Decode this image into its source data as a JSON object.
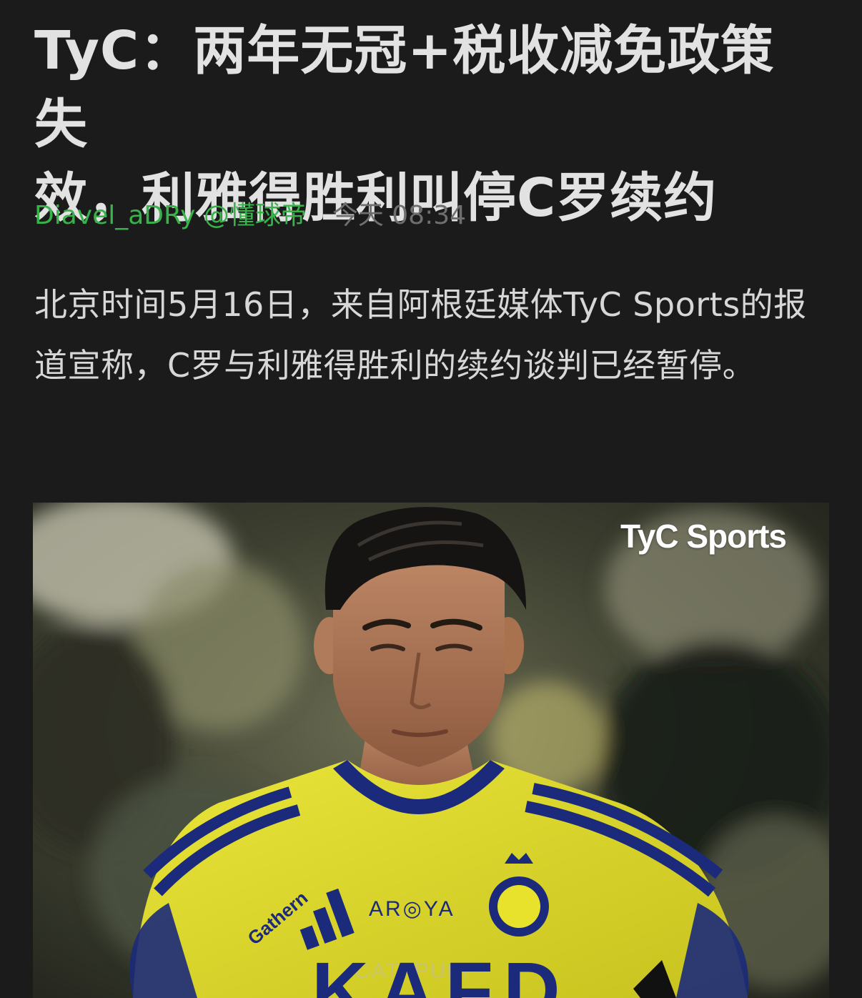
{
  "article": {
    "title_line1": "TyC：两年无冠+税收减免政策失",
    "title_line2": "效，利雅得胜利叫停C罗续约",
    "author": "Diavel_aDRy @懂球帝",
    "time": "今天 08:34",
    "body": "北京时间5月16日，来自阿根廷媒体TyC Sports的报道宣称，C罗与利雅得胜利的续约谈判已经暂停。"
  },
  "photo": {
    "watermark": "TyC Sports",
    "shirt_text_1": "Gathern",
    "shirt_text_2": "AR◎YA",
    "shirt_text_3": "KAFD",
    "shirt_text_4": "CATAPULT",
    "colors": {
      "jersey_yellow": "#e9e22c",
      "jersey_blue": "#1b2a7a",
      "hair": "#151412"
    }
  }
}
